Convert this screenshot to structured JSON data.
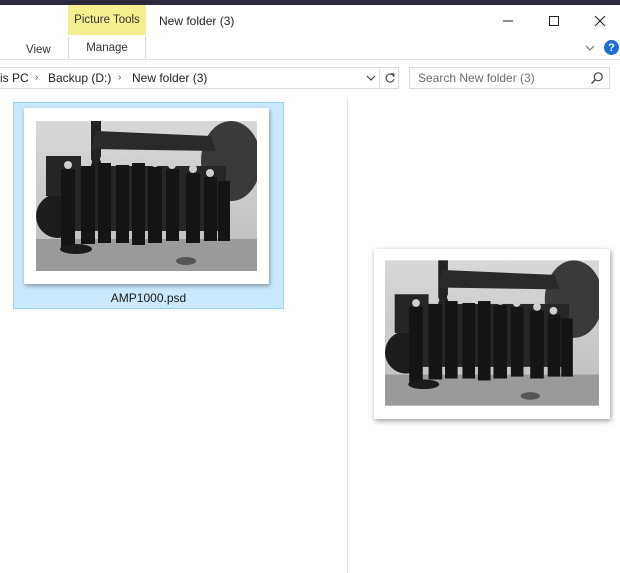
{
  "window": {
    "title": "New folder (3)",
    "context_tab": "Picture Tools"
  },
  "ribbon": {
    "tabs": [
      {
        "label": "View"
      },
      {
        "label": "Manage"
      }
    ]
  },
  "address": {
    "crumbs": [
      "is PC",
      "Backup (D:)",
      "New folder (3)"
    ]
  },
  "search": {
    "placeholder": "Search New folder (3)"
  },
  "files": [
    {
      "name": "AMP1000.psd",
      "selected": true
    }
  ],
  "icons": {
    "minimize": "minimize-icon",
    "maximize": "maximize-icon",
    "close": "close-icon",
    "help": "help-icon",
    "search": "search-icon",
    "refresh": "refresh-icon"
  },
  "colors": {
    "selection_fill": "#cce8ff",
    "selection_border": "#99d1ff",
    "context_tab": "#f5f08f",
    "help_blue": "#1f6fd1"
  }
}
